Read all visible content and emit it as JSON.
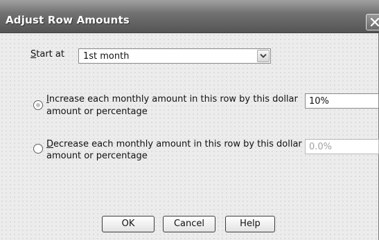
{
  "dialog": {
    "title": "Adjust Row Amounts"
  },
  "start_at": {
    "label_mnemonic": "S",
    "label_rest": "tart at",
    "selected": "1st month"
  },
  "increase": {
    "line1_mnemonic": "I",
    "line1_rest": "ncrease each monthly amount in this row by this dollar",
    "line2": "amount or percentage",
    "value": "10%",
    "selected": true
  },
  "decrease": {
    "line1_mnemonic": "D",
    "line1_rest": "ecrease each monthly amount in this row by this dollar",
    "line2": "amount or percentage",
    "value": "0.0%",
    "selected": false
  },
  "buttons": {
    "ok": "OK",
    "cancel": "Cancel",
    "help": "Help"
  },
  "icons": {
    "close": "close-icon",
    "dropdown": "chevron-down-icon"
  }
}
